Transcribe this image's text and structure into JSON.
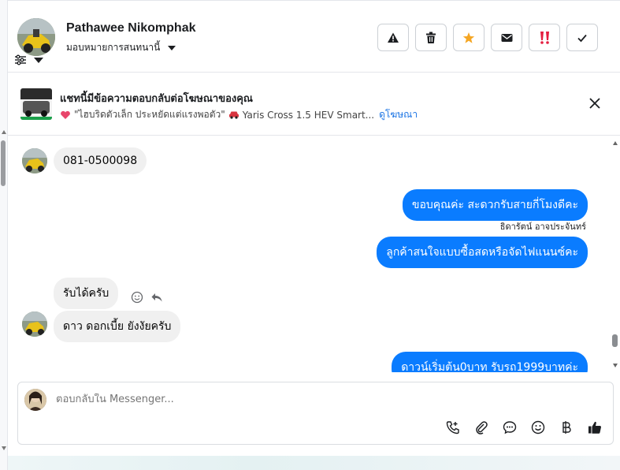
{
  "header": {
    "contact_name": "Pathawee Nikomphak",
    "assign_label": "มอบหมายการสนทนานี้",
    "actions": [
      {
        "name": "report-button",
        "icon": "warning-icon"
      },
      {
        "name": "delete-button",
        "icon": "trash-icon"
      },
      {
        "name": "star-button",
        "icon": "star-icon"
      },
      {
        "name": "mark-unread-button",
        "icon": "envelope-icon"
      },
      {
        "name": "spam-button",
        "icon": "exclamation-icon"
      },
      {
        "name": "done-button",
        "icon": "check-icon"
      }
    ]
  },
  "ad_banner": {
    "title": "แชทนี้มีข้อความตอบกลับต่อโฆษณาของคุณ",
    "ad_text": "\"ไฮบริดตัวเล็ก ประหยัดแต่แรงพอตัว\"",
    "car_text": "Yaris Cross 1.5 HEV Smart...",
    "link": "ดูโฆษณา"
  },
  "messages": [
    {
      "direction": "in",
      "text": "081-0500098"
    },
    {
      "direction": "out",
      "text": "ขอบคุณค่ะ สะดวกรับสายกี่โมงดีคะ"
    },
    {
      "direction": "sender",
      "text": "ธิดารัตน์ อาจประจันทร์"
    },
    {
      "direction": "out",
      "text": "ลูกค้าสนใจแบบซื้อสดหรือจัดไฟแนนซ์คะ"
    },
    {
      "direction": "in",
      "text": "รับได้ครับ"
    },
    {
      "direction": "in",
      "text": "ดาว ดอกเบี้ย ยังงัยครับ"
    },
    {
      "direction": "out",
      "text": "ดาวน์เริ่มต้น0บาท รับรถ1999บาทค่ะ"
    }
  ],
  "composer": {
    "placeholder": "ตอบกลับใน Messenger...",
    "tools": [
      "call-add-icon",
      "attachment-icon",
      "saved-reply-icon",
      "emoji-icon",
      "baht-icon",
      "thumbs-up-icon"
    ]
  },
  "colors": {
    "outgoing_bubble": "#0a7cff",
    "incoming_bubble": "#f0f0f0",
    "link": "#1b74e4",
    "star": "#f5a623",
    "spam": "#e41e3f"
  }
}
